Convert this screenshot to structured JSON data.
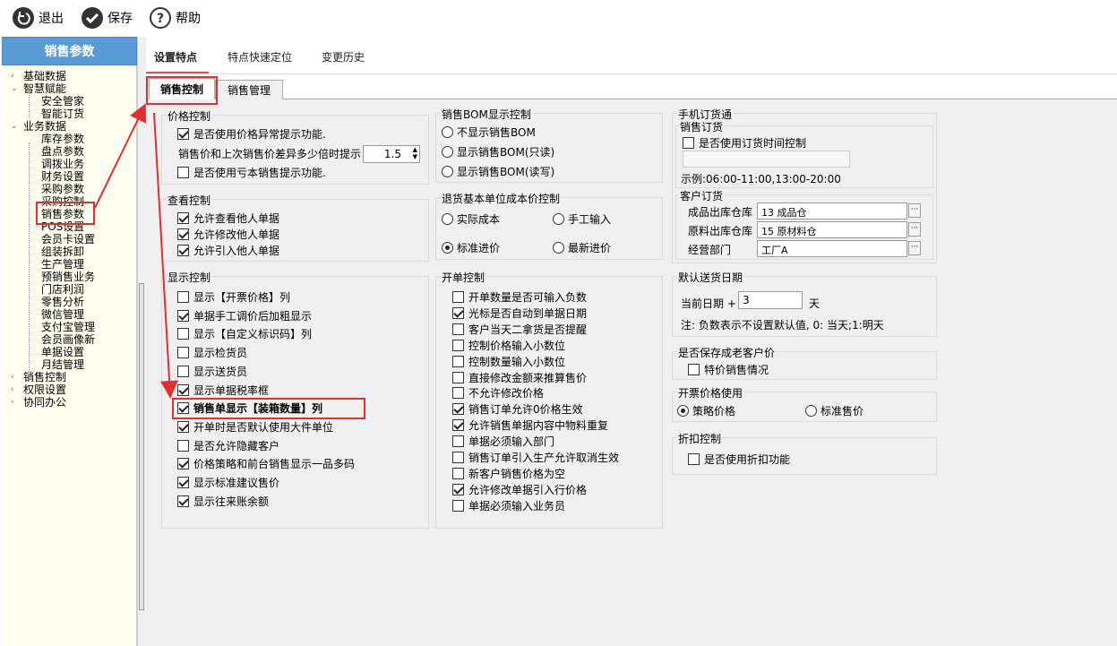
{
  "toolbar": {
    "exit": "退出",
    "save": "保存",
    "help": "帮助"
  },
  "sidebar": {
    "title": "销售参数",
    "tree": [
      {
        "label": "基础数据",
        "level": 0,
        "toggle": ">"
      },
      {
        "label": "智慧赋能",
        "level": 0,
        "toggle": "v"
      },
      {
        "label": "安全管家",
        "level": 1
      },
      {
        "label": "智能订货",
        "level": 1
      },
      {
        "label": "业务数据",
        "level": 0,
        "toggle": "v"
      },
      {
        "label": "库存参数",
        "level": 1
      },
      {
        "label": "盘点参数",
        "level": 1
      },
      {
        "label": "调拨业务",
        "level": 1
      },
      {
        "label": "财务设置",
        "level": 1
      },
      {
        "label": "采购参数",
        "level": 1
      },
      {
        "label": "采购控制",
        "level": 1
      },
      {
        "label": "销售参数",
        "level": 1
      },
      {
        "label": "POS设置",
        "level": 1
      },
      {
        "label": "会员卡设置",
        "level": 1
      },
      {
        "label": "组装拆卸",
        "level": 1
      },
      {
        "label": "生产管理",
        "level": 1
      },
      {
        "label": "预销售业务",
        "level": 1
      },
      {
        "label": "门店利润",
        "level": 1
      },
      {
        "label": "零售分析",
        "level": 1
      },
      {
        "label": "微信管理",
        "level": 1
      },
      {
        "label": "支付宝管理",
        "level": 1
      },
      {
        "label": "会员画像新",
        "level": 1
      },
      {
        "label": "单据设置",
        "level": 1
      },
      {
        "label": "月结管理",
        "level": 1
      },
      {
        "label": "销售控制",
        "level": 0,
        "toggle": ">"
      },
      {
        "label": "权限设置",
        "level": 0,
        "toggle": ">"
      },
      {
        "label": "协同办公",
        "level": 0,
        "toggle": ">"
      }
    ]
  },
  "top_tabs": [
    "设置特点",
    "特点快速定位",
    "变更历史"
  ],
  "inner_tabs": [
    "销售控制",
    "销售管理"
  ],
  "price_control": {
    "title": "价格控制",
    "items": [
      {
        "label": "是否使用价格异常提示功能.",
        "checked": true
      },
      {
        "label": "是否使用亏本销售提示功能.",
        "checked": false
      }
    ],
    "diff_label": "销售价和上次销售价差异多少倍时提示",
    "diff_value": "1.5"
  },
  "view_control": {
    "title": "查看控制",
    "items": [
      {
        "label": "允许查看他人单据",
        "checked": true
      },
      {
        "label": "允许修改他人单据",
        "checked": true
      },
      {
        "label": "允许引入他人单据",
        "checked": true
      }
    ]
  },
  "display_control": {
    "title": "显示控制",
    "items": [
      {
        "label": "显示【开票价格】列",
        "checked": false
      },
      {
        "label": "单据手工调价后加粗显示",
        "checked": true
      },
      {
        "label": "显示【自定义标识码】列",
        "checked": false
      },
      {
        "label": "显示检货员",
        "checked": false
      },
      {
        "label": "显示送货员",
        "checked": false
      },
      {
        "label": "显示单据税率框",
        "checked": true
      },
      {
        "label": "销售单显示【装箱数量】列",
        "checked": true
      },
      {
        "label": "开单时是否默认使用大件单位",
        "checked": true
      },
      {
        "label": "是否允许隐藏客户",
        "checked": false
      },
      {
        "label": "价格策略和前台销售显示一品多码",
        "checked": true
      },
      {
        "label": "显示标准建议售价",
        "checked": true
      },
      {
        "label": "显示往来账余额",
        "checked": true
      }
    ]
  },
  "bom_control": {
    "title": "销售BOM显示控制",
    "options": [
      {
        "label": "不显示销售BOM",
        "selected": false
      },
      {
        "label": "显示销售BOM(只读)",
        "selected": false
      },
      {
        "label": "显示销售BOM(读写)",
        "selected": false
      }
    ]
  },
  "return_cost": {
    "title": "退货基本单位成本价控制",
    "options": [
      {
        "label": "实际成本",
        "selected": false
      },
      {
        "label": "手工输入",
        "selected": false
      },
      {
        "label": "标准进价",
        "selected": true
      },
      {
        "label": "最新进价",
        "selected": false
      }
    ]
  },
  "order_control": {
    "title": "开单控制",
    "items": [
      {
        "label": "开单数量是否可输入负数",
        "checked": false
      },
      {
        "label": "光标是否自动到单据日期",
        "checked": true
      },
      {
        "label": "客户当天二拿货是否提醒",
        "checked": false
      },
      {
        "label": "控制价格输入小数位",
        "checked": false
      },
      {
        "label": "控制数量输入小数位",
        "checked": false
      },
      {
        "label": "直接修改金额来推算售价",
        "checked": false
      },
      {
        "label": "不允许修改价格",
        "checked": false
      },
      {
        "label": "销售订单允许0价格生效",
        "checked": true
      },
      {
        "label": "允许销售单据内容中物料重复",
        "checked": true
      },
      {
        "label": "单据必须输入部门",
        "checked": false
      },
      {
        "label": "销售订单引入生产允许取消生效",
        "checked": false
      },
      {
        "label": "新客户销售价格为空",
        "checked": false
      },
      {
        "label": "允许修改单据引入行价格",
        "checked": true
      },
      {
        "label": "单据必须输入业务员",
        "checked": false
      }
    ]
  },
  "mobile_order": {
    "title": "手机订货通",
    "sub_title": "销售订货",
    "time_label": "是否使用订货时间控制",
    "time_checked": false,
    "time_value": "",
    "example": "示例:06:00-11:00,13:00-20:00"
  },
  "customer_order": {
    "title": "客户订货",
    "fields": [
      {
        "label": "成品出库仓库",
        "value": "13 成品仓"
      },
      {
        "label": "原料出库仓库",
        "value": "15 原材料仓"
      },
      {
        "label": "经营部门",
        "value": "工厂A"
      }
    ]
  },
  "delivery_date": {
    "title": "默认送货日期",
    "prefix": "当前日期 +",
    "value": "3",
    "unit": "天",
    "note": "注: 负数表示不设置默认值, 0: 当天;1:明天"
  },
  "old_customer": {
    "title": "是否保存成老客户价",
    "label": "特价销售情况",
    "checked": false
  },
  "invoice_price": {
    "title": "开票价格使用",
    "options": [
      {
        "label": "策略价格",
        "selected": true
      },
      {
        "label": "标准售价",
        "selected": false
      }
    ]
  },
  "discount": {
    "title": "折扣控制",
    "label": "是否使用折扣功能",
    "checked": false
  }
}
